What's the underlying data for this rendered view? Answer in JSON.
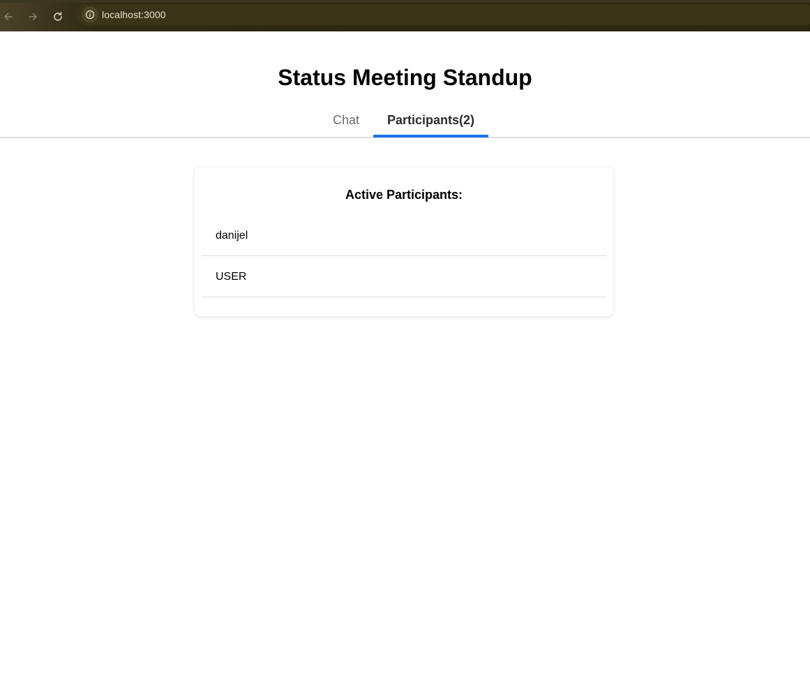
{
  "browser": {
    "url": "localhost:3000",
    "icons": {
      "back": "arrow-left-icon",
      "forward": "arrow-right-icon",
      "reload": "reload-icon",
      "site_info": "info-icon"
    }
  },
  "page": {
    "title": "Status Meeting Standup"
  },
  "tabs": {
    "chat_label": "Chat",
    "participants_label": "Participants(2)",
    "active": "participants",
    "accent_color": "#1a73e8"
  },
  "participants_panel": {
    "heading": "Active Participants:",
    "items": [
      {
        "name": "danijel"
      },
      {
        "name": "USER"
      }
    ]
  }
}
